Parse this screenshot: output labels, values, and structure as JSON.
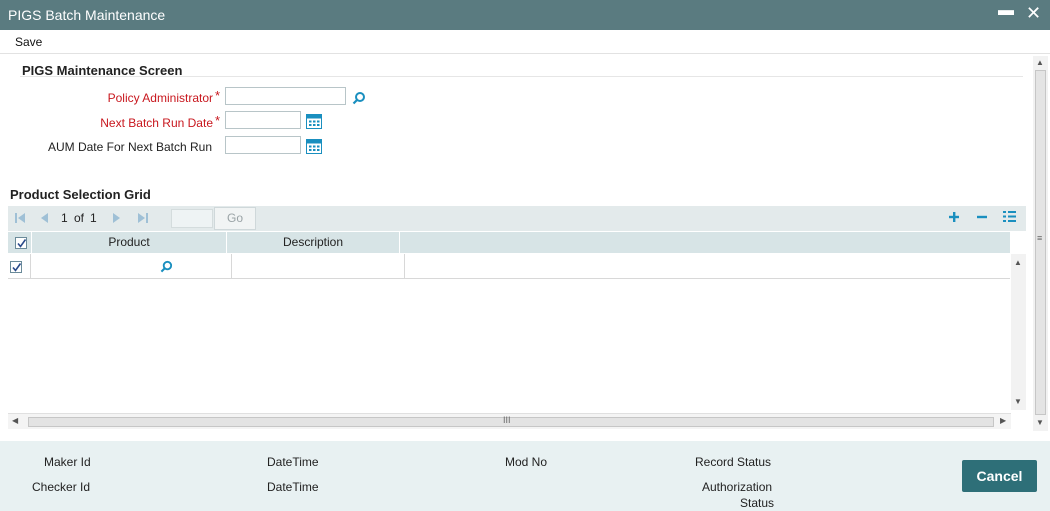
{
  "window": {
    "title": "PIGS Batch Maintenance",
    "minimize_glyph": "▬",
    "close_glyph": "✕"
  },
  "menu": {
    "save_label": "Save"
  },
  "form": {
    "section_title": "PIGS Maintenance Screen",
    "policy_admin_label": "Policy Administrator",
    "next_batch_label": "Next Batch Run Date",
    "aum_date_label": "AUM Date For Next Batch Run",
    "required_mark": "*",
    "policy_admin_value": "",
    "next_batch_value": "",
    "aum_date_value": ""
  },
  "grid": {
    "section_title": "Product Selection Grid",
    "pager": {
      "page": "1",
      "of_label": "of",
      "total": "1",
      "go_label": "Go"
    },
    "columns": [
      "Product",
      "Description"
    ],
    "rows": [
      {
        "product": "",
        "description": "",
        "checked": true
      }
    ],
    "header_checked": true,
    "hscroll_grip": "III"
  },
  "footer": {
    "maker_id_label": "Maker Id",
    "checker_id_label": "Checker Id",
    "datetime_label_1": "DateTime",
    "datetime_label_2": "DateTime",
    "mod_no_label": "Mod No",
    "record_status_label": "Record Status",
    "authorization_label_line1": "Authorization",
    "authorization_label_line2": "Status",
    "cancel_label": "Cancel"
  },
  "colors": {
    "titlebar": "#5a7b80",
    "accent_icon": "#1a8fbf",
    "required": "#c8171e",
    "cancel_button": "#2e6f78"
  }
}
